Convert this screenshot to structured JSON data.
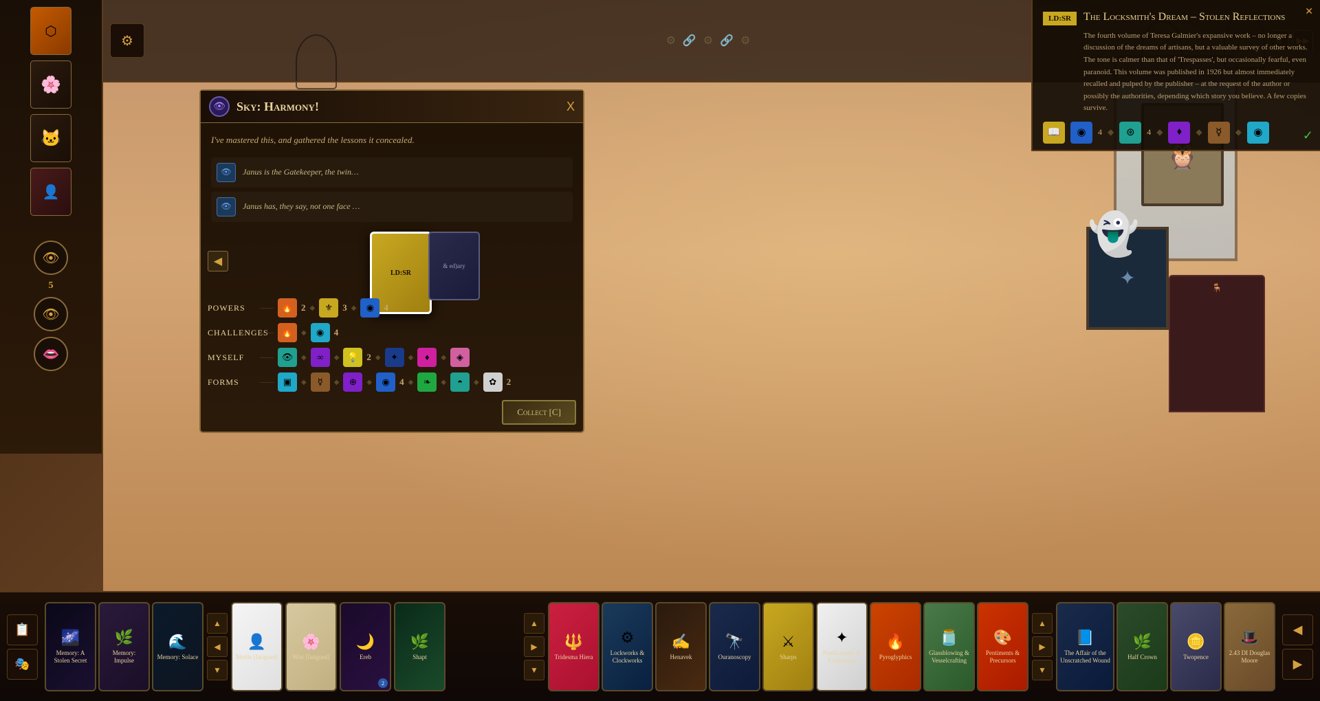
{
  "dialog": {
    "title": "Sky: Harmony!",
    "close_label": "X",
    "description": "I've mastered this, and gathered the lessons it concealed.",
    "lessons": [
      {
        "text": "Janus is the Gatekeeper, the twin…"
      },
      {
        "text": "Janus has, they say, not one face …"
      }
    ],
    "card_label": "LD:SR",
    "second_card_label": "& ed)ary",
    "collect_button": "Collect [C]",
    "stat_rows": [
      {
        "label": "Powers",
        "items": [
          {
            "color": "orange",
            "symbol": "🔥"
          },
          {
            "value": "2"
          },
          {
            "dot": "◆"
          },
          {
            "color": "gold",
            "symbol": "⚜"
          },
          {
            "value": "3"
          },
          {
            "dot": "◆"
          },
          {
            "color": "blue",
            "symbol": "◉"
          },
          {
            "value": "4"
          }
        ]
      },
      {
        "label": "Challenges",
        "items": [
          {
            "color": "orange",
            "symbol": "🔥"
          },
          {
            "dot": "◆"
          },
          {
            "color": "cyan",
            "symbol": "◉"
          },
          {
            "value": "4"
          }
        ]
      },
      {
        "label": "Myself",
        "items": [
          {
            "color": "teal",
            "symbol": "👁"
          },
          {
            "dot": "◆"
          },
          {
            "color": "purple",
            "symbol": "∞"
          },
          {
            "dot": "◆"
          },
          {
            "color": "yellow",
            "symbol": "💡"
          },
          {
            "value": "2"
          },
          {
            "dot": "◆"
          },
          {
            "color": "darkblue",
            "symbol": "✦"
          },
          {
            "dot": "◆"
          },
          {
            "color": "magenta",
            "symbol": "♦"
          },
          {
            "dot": "◆"
          },
          {
            "color": "pink",
            "symbol": "◈"
          }
        ]
      },
      {
        "label": "Forms",
        "items": [
          {
            "color": "cyan",
            "symbol": "▣"
          },
          {
            "dot": "◆"
          },
          {
            "color": "brown",
            "symbol": "☿"
          },
          {
            "dot": "◆"
          },
          {
            "color": "purple",
            "symbol": "⊕"
          },
          {
            "dot": "◆"
          },
          {
            "color": "blue",
            "symbol": "◉"
          },
          {
            "value": "4"
          },
          {
            "dot": "◆"
          },
          {
            "color": "green",
            "symbol": "❧"
          },
          {
            "dot": "◆"
          },
          {
            "color": "teal",
            "symbol": "◓"
          },
          {
            "dot": "◆"
          },
          {
            "color": "white",
            "symbol": "✿"
          },
          {
            "value": "2"
          }
        ]
      }
    ]
  },
  "right_panel": {
    "label": "LD:SR",
    "title": "The Locksmith's Dream – Stolen Reflections",
    "description": "The fourth volume of Teresa Galmier's expansive work – no longer a discussion of the dreams of artisans, but a valuable survey of other works. The tone is calmer than that of 'Trespasses', but occasionally fearful, even paranoid. This volume was published in 1926 but almost immediately recalled and pulped by the publisher – at the request of the author or possibly the authorities, depending which story you believe. A few copies survive.",
    "requirements": [
      {
        "color": "gold",
        "symbol": "📖",
        "value": null
      },
      {
        "color": "blue",
        "symbol": "◉",
        "value": "4"
      },
      {
        "dot": "◆"
      },
      {
        "color": "teal",
        "symbol": "⊛",
        "value": "4"
      },
      {
        "dot": "◆"
      },
      {
        "color": "purple",
        "symbol": "♦",
        "value": null
      },
      {
        "dot": "◆"
      },
      {
        "color": "brown",
        "symbol": "☿",
        "value": null
      },
      {
        "dot": "◆"
      },
      {
        "color": "cyan",
        "symbol": "◉",
        "value": null
      }
    ]
  },
  "bottom_bar": {
    "left_cards": [
      {
        "id": "memory-secret",
        "label": "Memory: A Stolen Secret",
        "bg": "bc-memory1",
        "icon": "🌌"
      },
      {
        "id": "memory-impulse",
        "label": "Memory: Impulse",
        "bg": "bc-memory2",
        "icon": "🌿"
      },
      {
        "id": "memory-solace",
        "label": "Memory: Solace",
        "bg": "bc-memory3",
        "icon": "🌊"
      }
    ],
    "main_cards": [
      {
        "id": "mettle",
        "label": "Mettle [fatigued]",
        "bg": "bc-mettle",
        "icon": "👤"
      },
      {
        "id": "wist",
        "label": "Wist [fatigued]",
        "bg": "bc-wist",
        "icon": "🌸"
      },
      {
        "id": "ereb",
        "label": "Ereb",
        "bg": "bc-ereb",
        "icon": "🌙",
        "badge": "2"
      },
      {
        "id": "shapt",
        "label": "Shapt",
        "bg": "bc-shapt",
        "icon": "🌿"
      },
      {
        "id": "tridesma",
        "label": "Tridesma Hiera",
        "bg": "bc-tridesma",
        "icon": "🔱"
      },
      {
        "id": "lockworks",
        "label": "Lockworks & Clockworks",
        "bg": "bc-lockworks",
        "icon": "⚙"
      },
      {
        "id": "henavek",
        "label": "Henavek",
        "bg": "bc-henavek",
        "icon": "✍"
      },
      {
        "id": "ouranoscopy",
        "label": "Ouranoscopy",
        "bg": "bc-ouranoscopy",
        "icon": "🔭"
      },
      {
        "id": "sharps",
        "label": "Sharps",
        "bg": "bc-sharps",
        "icon": "⚔"
      },
      {
        "id": "purifications",
        "label": "Purifications & Exaltations",
        "bg": "bc-purifications",
        "icon": "✦"
      },
      {
        "id": "pyroglyphics",
        "label": "Pyroglyphics",
        "bg": "bc-pyroglyphics",
        "icon": "🔥"
      },
      {
        "id": "glasblowing",
        "label": "Glassblowing & Vesselcrafting",
        "bg": "bc-glasblowing",
        "icon": "🫙"
      },
      {
        "id": "pentiments",
        "label": "Pentiments & Precursors",
        "bg": "bc-pentiments",
        "icon": "🎨"
      }
    ],
    "right_cards": [
      {
        "id": "affair",
        "label": "The Affair of the Unscratched Wound",
        "bg": "bc-affair",
        "icon": "📘"
      },
      {
        "id": "halfcrown",
        "label": "Half Crown",
        "bg": "bc-halfcrown",
        "icon": "🌿"
      },
      {
        "id": "twopence",
        "label": "Twopence",
        "bg": "bc-twopence",
        "icon": "🪙"
      },
      {
        "id": "douglas",
        "label": "2.43 DI Douglas Moore",
        "bg": "bc-douglas",
        "icon": "🎩"
      }
    ]
  },
  "sidebar": {
    "items": [
      {
        "id": "card1",
        "symbol": "⬡",
        "bg": "orange"
      },
      {
        "id": "card2",
        "symbol": "🌸",
        "bg": "dark"
      },
      {
        "id": "card3",
        "symbol": "🐱",
        "bg": "dark"
      },
      {
        "id": "card4",
        "symbol": "👤",
        "bg": "maroon"
      }
    ],
    "number": "5"
  },
  "icons": {
    "eye": "👁",
    "lips": "👄",
    "gear": "⚙",
    "arrow_left": "◀",
    "arrow_right": "▶",
    "close": "✕",
    "chevron_up": "▲",
    "chevron_down": "▼",
    "check": "✓",
    "scroll_left": "◀",
    "scroll_right": "▶"
  }
}
